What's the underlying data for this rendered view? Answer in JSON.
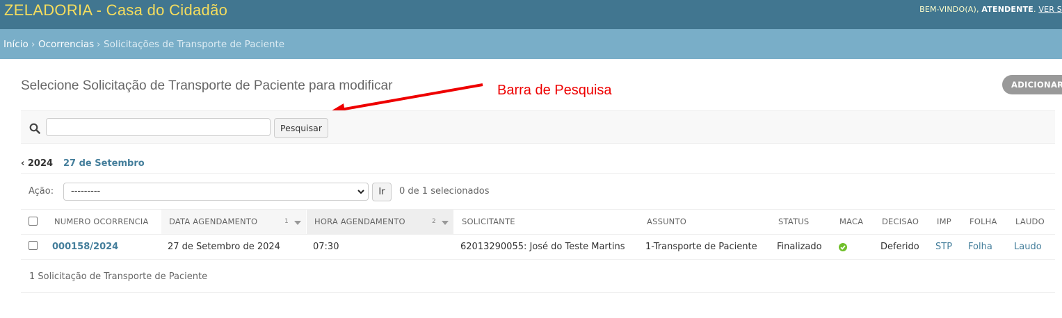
{
  "header": {
    "brand": "ZELADORIA - Casa do Cidadão",
    "welcome": "BEM-VINDO(A), ",
    "user": "ATENDENTE",
    "period": ". ",
    "view_site": "VER S"
  },
  "breadcrumbs": {
    "home": "Início",
    "sep": "›",
    "section": "Ocorrencias",
    "current": "Solicitações de Transporte de Paciente"
  },
  "page": {
    "title": "Selecione Solicitação de Transporte de Paciente para modificar",
    "add_button": "ADICIONAR"
  },
  "annotation": {
    "text": "Barra de Pesquisa",
    "color": "#e00000"
  },
  "search": {
    "value": "",
    "button": "Pesquisar"
  },
  "date_hierarchy": {
    "year": "‹ 2024",
    "month": "27 de Setembro"
  },
  "actions": {
    "label": "Ação:",
    "selected": "---------",
    "go": "Ir",
    "counter": "0 de 1 selecionados"
  },
  "table": {
    "columns": [
      {
        "label": "NUMERO OCORRENCIA"
      },
      {
        "label": "DATA AGENDAMENTO",
        "sort_order": "1"
      },
      {
        "label": "HORA AGENDAMENTO",
        "sort_order": "2"
      },
      {
        "label": "SOLICITANTE"
      },
      {
        "label": "ASSUNTO"
      },
      {
        "label": "STATUS"
      },
      {
        "label": "MACA"
      },
      {
        "label": "DECISAO"
      },
      {
        "label": "IMP"
      },
      {
        "label": "FOLHA"
      },
      {
        "label": "LAUDO"
      }
    ],
    "rows": [
      {
        "numero": "000158/2024",
        "data": "27 de Setembro de 2024",
        "hora": "07:30",
        "solicitante": "62013290055: José do Teste Martins",
        "assunto": "1-Transporte de Paciente",
        "status": "Finalizado",
        "maca_icon": "check-circle-icon",
        "decisao": "Deferido",
        "imp": "STP",
        "folha": "Folha",
        "laudo": "Laudo"
      }
    ]
  },
  "paginator": "1 Solicitação de Transporte de Paciente",
  "colors": {
    "header_bg": "#417690",
    "brand_text": "#f5dd5d",
    "breadcrumb_bg": "#79aec8",
    "link": "#447e9b",
    "check": "#70bf2b"
  }
}
